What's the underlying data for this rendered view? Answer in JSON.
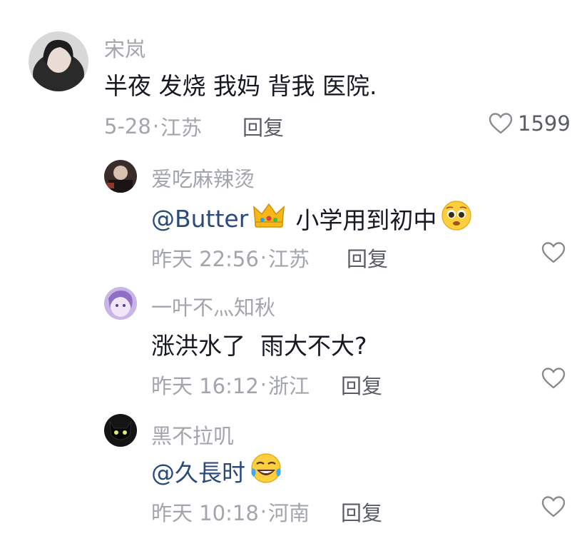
{
  "comments": [
    {
      "username": "宋岚",
      "text": "半夜 发烧 我妈 背我 医院.",
      "date": "5-28",
      "location": "江苏",
      "reply_label": "回复",
      "likes": "1599"
    },
    {
      "username": "爱吃麻辣烫",
      "mention": "@Butter",
      "text": "小学用到初中",
      "date": "昨天 22:56",
      "location": "江苏",
      "reply_label": "回复",
      "likes": ""
    },
    {
      "username": "一叶不灬知秋",
      "text": "涨洪水了  雨大不大?",
      "date": "昨天 16:12",
      "location": "浙江",
      "reply_label": "回复",
      "likes": ""
    },
    {
      "username": "黑不拉叽",
      "mention": "@久長时",
      "text": "",
      "date": "昨天 10:18",
      "location": "河南",
      "reply_label": "回复",
      "likes": ""
    }
  ],
  "meta_separator": "·",
  "icons": {
    "like": "heart-outline-icon",
    "crown": "crown-emoji",
    "pleading": "pleading-face-emoji",
    "laughing": "rolling-laughing-emoji"
  },
  "colors": {
    "text": "#161823",
    "secondary": "#a3a5ad",
    "mention": "#2a4a7c"
  }
}
